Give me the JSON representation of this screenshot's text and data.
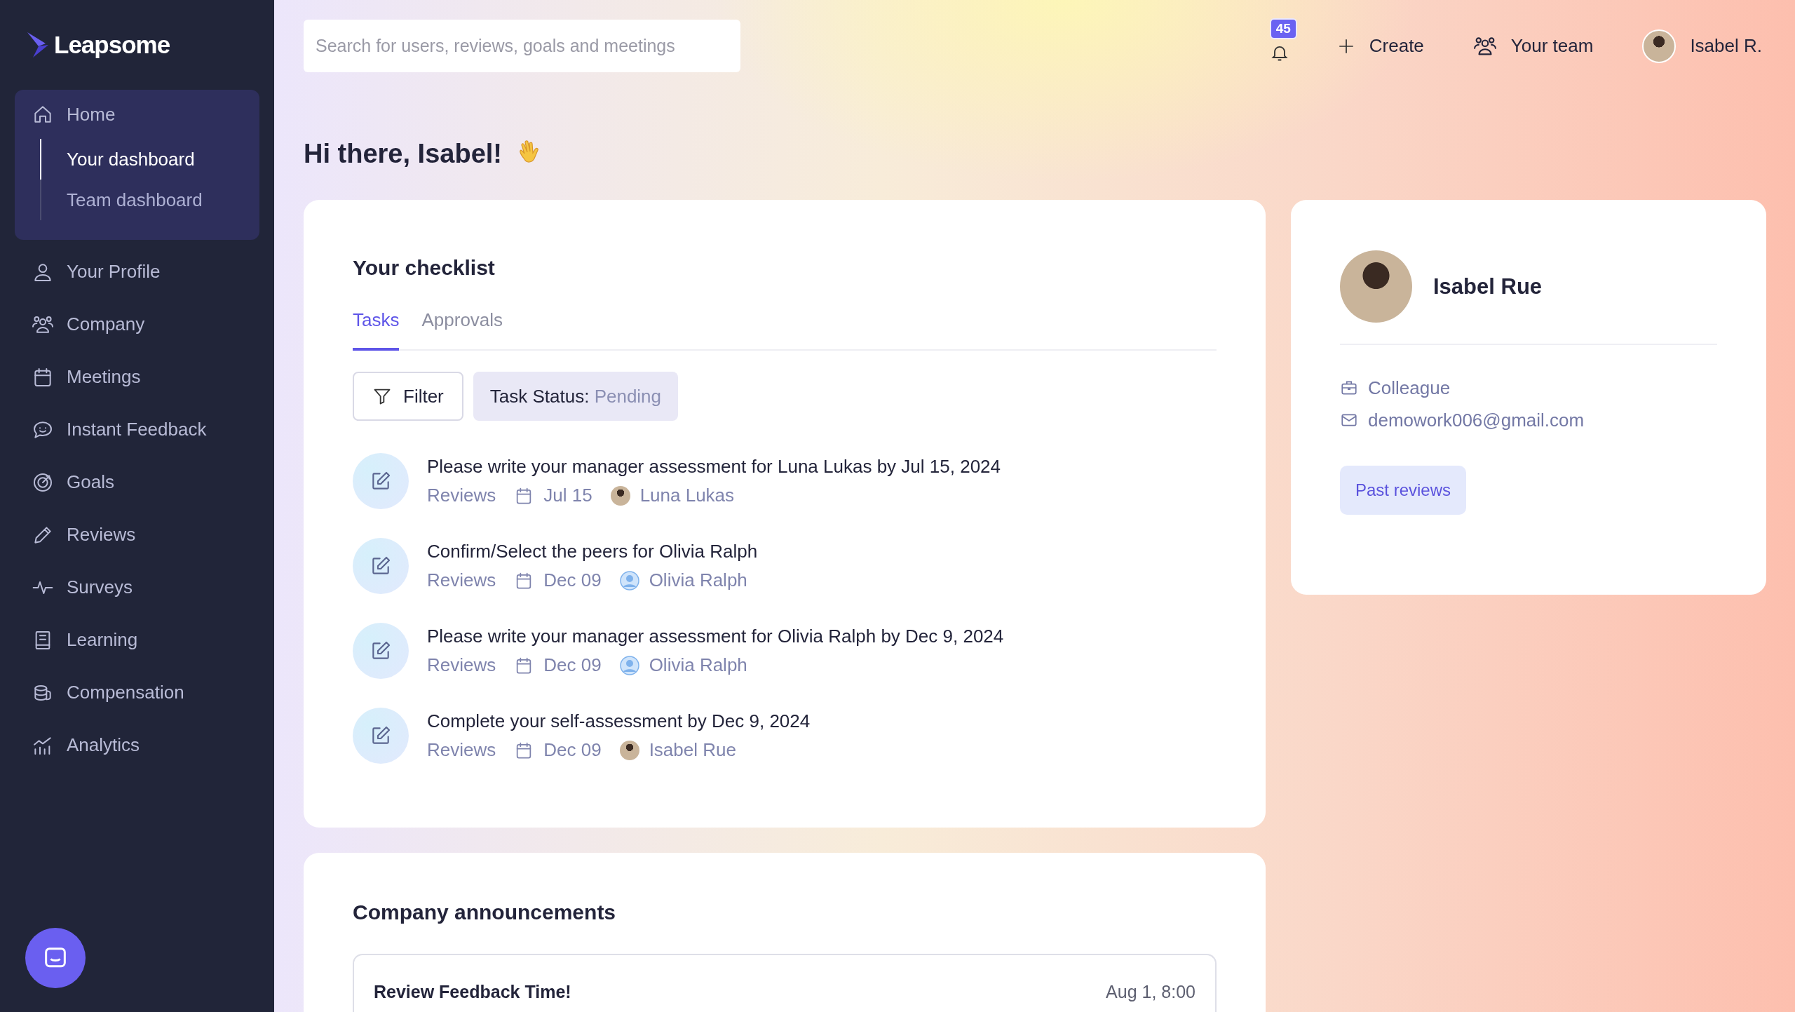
{
  "brand": {
    "name": "Leapsome"
  },
  "sidebar": {
    "items": [
      {
        "label": "Home",
        "kind": "home",
        "expanded": true,
        "children": [
          {
            "label": "Your dashboard",
            "selected": true
          },
          {
            "label": "Team dashboard",
            "selected": false
          }
        ]
      },
      {
        "label": "Your Profile",
        "kind": "user"
      },
      {
        "label": "Company",
        "kind": "users"
      },
      {
        "label": "Meetings",
        "kind": "calendar"
      },
      {
        "label": "Instant Feedback",
        "kind": "chat"
      },
      {
        "label": "Goals",
        "kind": "target"
      },
      {
        "label": "Reviews",
        "kind": "pencil"
      },
      {
        "label": "Surveys",
        "kind": "pulse"
      },
      {
        "label": "Learning",
        "kind": "book"
      },
      {
        "label": "Compensation",
        "kind": "coins"
      },
      {
        "label": "Analytics",
        "kind": "chart"
      }
    ]
  },
  "search": {
    "placeholder": "Search for users, reviews, goals and meetings"
  },
  "header": {
    "notification_count": "45",
    "actions": [
      {
        "kind": "create",
        "label": "Create"
      },
      {
        "kind": "team",
        "label": "Your team"
      },
      {
        "kind": "user",
        "label": "Isabel R."
      }
    ]
  },
  "greeting": "Hi there, Isabel!",
  "checklist": {
    "title": "Your checklist",
    "tabs": [
      {
        "label": "Tasks",
        "selected": true
      },
      {
        "label": "Approvals",
        "selected": false
      }
    ],
    "filter_button": "Filter",
    "status_chip": {
      "label": "Task Status:",
      "value": "Pending"
    },
    "tasks": [
      {
        "title": "Please write your manager assessment for Luna Lukas by Jul 15, 2024",
        "category": "Reviews",
        "due": "Jul 15",
        "person": "Luna Lukas",
        "kind": "photo"
      },
      {
        "title": "Confirm/Select the peers for Olivia Ralph",
        "category": "Reviews",
        "due": "Dec 09",
        "person": "Olivia Ralph",
        "kind": "generic"
      },
      {
        "title": "Please write your manager assessment for Olivia Ralph by Dec 9, 2024",
        "category": "Reviews",
        "due": "Dec 09",
        "person": "Olivia Ralph",
        "kind": "generic"
      },
      {
        "title": "Complete your self-assessment by Dec 9, 2024",
        "category": "Reviews",
        "due": "Dec 09",
        "person": "Isabel Rue",
        "kind": "photo"
      }
    ]
  },
  "profile": {
    "name": "Isabel Rue",
    "role": "Colleague",
    "email": "demowork006@gmail.com",
    "button": "Past reviews"
  },
  "announcements": {
    "title": "Company announcements",
    "items": [
      {
        "title": "Review Feedback Time!",
        "date": "Aug 1, 8:00"
      }
    ]
  }
}
